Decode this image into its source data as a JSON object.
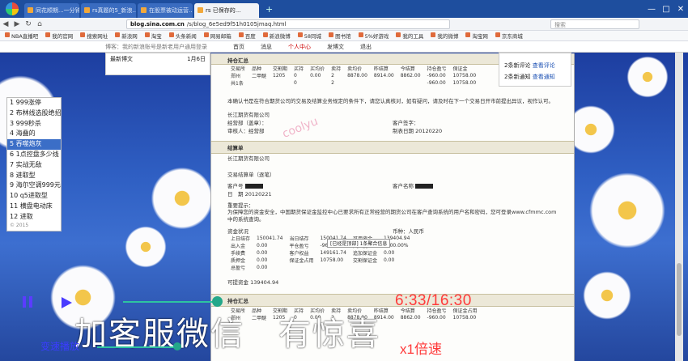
{
  "browser": {
    "tabs": [
      {
        "label": "同花顺期...一分钟..."
      },
      {
        "label": "rs真题的5_新浪..."
      },
      {
        "label": "在股票被动运营..."
      },
      {
        "label": "rs 已保存的..."
      }
    ],
    "active_tab": 3,
    "new_tab": "+",
    "url_host": "blog.sina.com.cn",
    "url_path": "/s/blog_6e5ed9f51h0105jmaq.html",
    "search_placeholder": "搜索",
    "window_controls": [
      "—",
      "□",
      "✕"
    ],
    "bookmarks": [
      "NBA直播吧",
      "我的官网",
      "搜索网址",
      "新浪网",
      "淘宝",
      "头条新闻",
      "网易邮箱",
      "百度",
      "新浪微博",
      "58同城",
      "图书馆",
      "5%好游戏",
      "我的工具",
      "我的微博",
      "淘宝网",
      "京东商城"
    ]
  },
  "blog_bar": {
    "notice": "博客：我的新浪账号是新老用户通用登录",
    "nav": [
      {
        "label": "首页",
        "red": false
      },
      {
        "label": "消息",
        "red": false
      },
      {
        "label": "个人中心",
        "red": true
      },
      {
        "label": "发博文",
        "red": false
      },
      {
        "label": "退出",
        "red": false
      }
    ]
  },
  "popup": {
    "title": "最新博文",
    "date": "1月6日"
  },
  "right_notice": {
    "line1": "2条新评论",
    "link1": "查看评论",
    "line2": "2条新通知",
    "link2": "查看通知"
  },
  "strategy_list": {
    "items": [
      "1 999涨停",
      "2 布林线选股绝招",
      "3 999秒杀",
      "4 海叠的",
      "5 吞噬炮灰",
      "6 1点控盘多少线",
      "7 实战无敌",
      "8 进取型",
      "9 海尔空调999元",
      "10 q5进取型",
      "11 横盘电动床",
      "12 进取"
    ],
    "selected_index": 4,
    "footer": "© 2015"
  },
  "document": {
    "section1": "持仓汇总",
    "table1_headers": [
      "交易所",
      "品种",
      "交割期",
      "买持",
      "买均价",
      "卖持",
      "卖均价",
      "昨结算",
      "今结算",
      "持仓盈亏",
      "保证金"
    ],
    "table1_rows": [
      [
        "郑州",
        "二甲醚",
        "1205",
        "0",
        "0.00",
        "2",
        "8878.00",
        "8914.00",
        "8862.00",
        "-960.00",
        "10758.00"
      ],
      [
        "共1条",
        "",
        "",
        "0",
        "",
        "2",
        "",
        "",
        "",
        "-960.00",
        "10758.00"
      ]
    ],
    "para1": "本确认书是在符合期货公司的交易及结算业务规定的条件下，请您认真核对，如有疑问，请及时在下一个交易日开市前提出异议，视作认可。",
    "company": "长江期货有限公司",
    "handler_label": "经营部（盖章）：",
    "sign_label": "客户签字：",
    "checker_label": "审核人：经营部",
    "date_label": "制表日期",
    "date_value": "20120220",
    "section2": "结算单",
    "company2": "长江期货有限公司",
    "statement_title": "交易结算单（逐笔）",
    "cust_no_label": "客户号",
    "cust_name_label": "客户名称",
    "date2_label": "日　期",
    "date2_value": "20120221",
    "important_label": "重要提示：",
    "para2": "为保障您的资金安全，中国期货保证金监控中心已要求所有正常经营的期货公司在客户查询系统的用户名和密码，您可登录www.cfmmc.com中的系统查询。",
    "fund_label": "资金状况",
    "currency": "币种：人民币",
    "funds": [
      [
        "上日结存",
        "150041.74",
        "当日结存",
        "150041.74",
        "可用资金",
        "139404.94"
      ],
      [
        "出入金",
        "0.00",
        "平仓盈亏",
        "-960.00",
        "风险度",
        "1000.00%"
      ],
      [
        "手续费",
        "0.00",
        "客户权益",
        "149161.74",
        "追加保证金",
        "0.00"
      ],
      [
        "质押金",
        "0.00",
        "保证金占用",
        "10758.00",
        "交割保证金",
        "0.00"
      ],
      [
        "总盈亏",
        "0.00",
        "",
        "",
        "",
        ""
      ]
    ],
    "available_label": "可提资金",
    "available_value": "139404.94",
    "section3": "持仓汇总",
    "table3_headers": [
      "交易所",
      "品种",
      "交割期",
      "买持",
      "买均价",
      "卖持",
      "卖均价",
      "昨结算",
      "今结算",
      "持仓盈亏",
      "保证金占用"
    ],
    "table3_rows": [
      [
        "郑州",
        "二甲醚",
        "1205",
        "0",
        "0.00",
        "2",
        "8878.00",
        "8914.00",
        "8862.00",
        "-960.00",
        "10758.00"
      ]
    ],
    "watermark": "coolyu",
    "tooltip": "[已经是顶部] 1条聚合信息"
  },
  "video": {
    "time": "6:33/16:30",
    "speed": "x1倍速",
    "speed_label": "变速播放",
    "progress_fraction": 0.4,
    "promo": "加客服微信　有惊喜"
  }
}
